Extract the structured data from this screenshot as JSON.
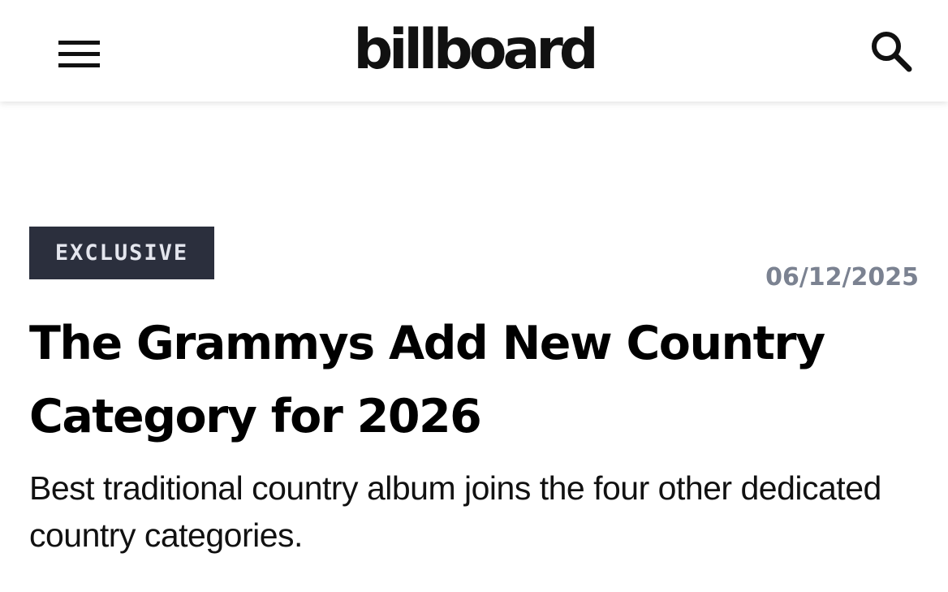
{
  "header": {
    "logo_text": "billboard",
    "menu_icon": "hamburger-menu-icon",
    "search_icon": "search-icon"
  },
  "article": {
    "tag": "EXCLUSIVE",
    "date": "06/12/2025",
    "headline": "The Grammys Add New Country Category for 2026",
    "dek": "Best traditional country album joins the four other dedicated country categories."
  },
  "colors": {
    "tag_background": "#2b2f3d",
    "tag_text": "#e4e6ee",
    "date_text": "#7b8291",
    "headline_text": "#000000"
  }
}
